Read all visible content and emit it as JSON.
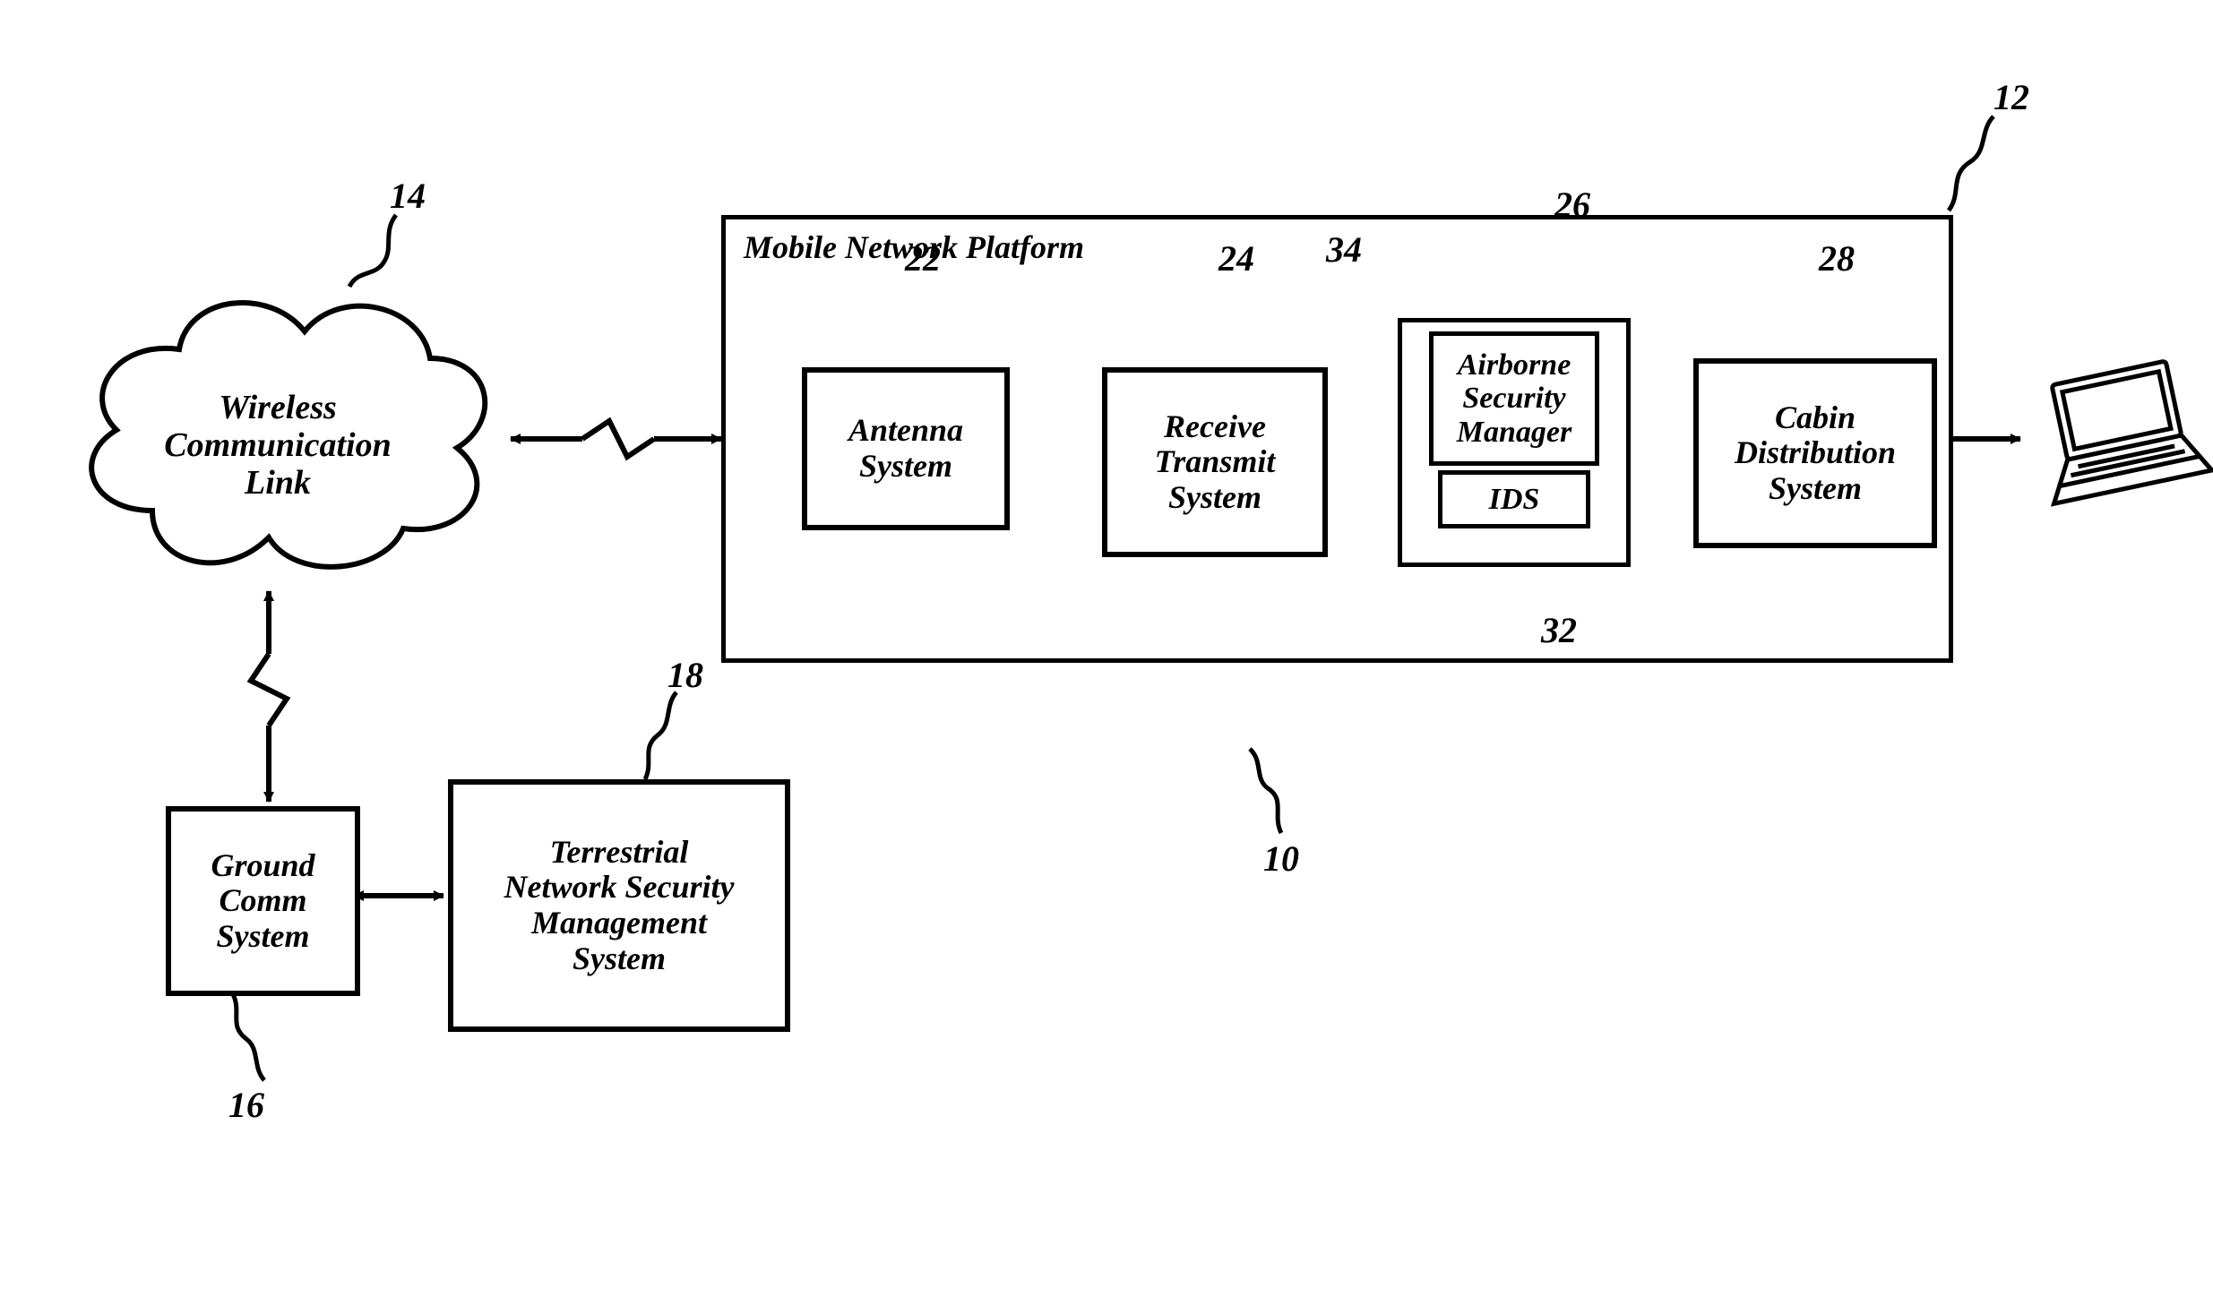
{
  "platform": {
    "title": "Mobile Network Platform"
  },
  "cloud": {
    "line1": "Wireless",
    "line2": "Communication",
    "line3": "Link"
  },
  "ground": {
    "line1": "Ground",
    "line2": "Comm",
    "line3": "System"
  },
  "terrestrial": {
    "line1": "Terrestrial",
    "line2": "Network Security",
    "line3": "Management",
    "line4": "System"
  },
  "antenna": {
    "line1": "Antenna",
    "line2": "System"
  },
  "rts": {
    "line1": "Receive",
    "line2": "Transmit",
    "line3": "System"
  },
  "asm": {
    "line1": "Airborne",
    "line2": "Security",
    "line3": "Manager"
  },
  "ids": {
    "label": "IDS"
  },
  "cabin": {
    "line1": "Cabin",
    "line2": "Distribution",
    "line3": "System"
  },
  "refs": {
    "r10": "10",
    "r12": "12",
    "r14": "14",
    "r16": "16",
    "r18": "18",
    "r22": "22",
    "r24": "24",
    "r26": "26",
    "r28": "28",
    "r32": "32",
    "r34": "34"
  }
}
